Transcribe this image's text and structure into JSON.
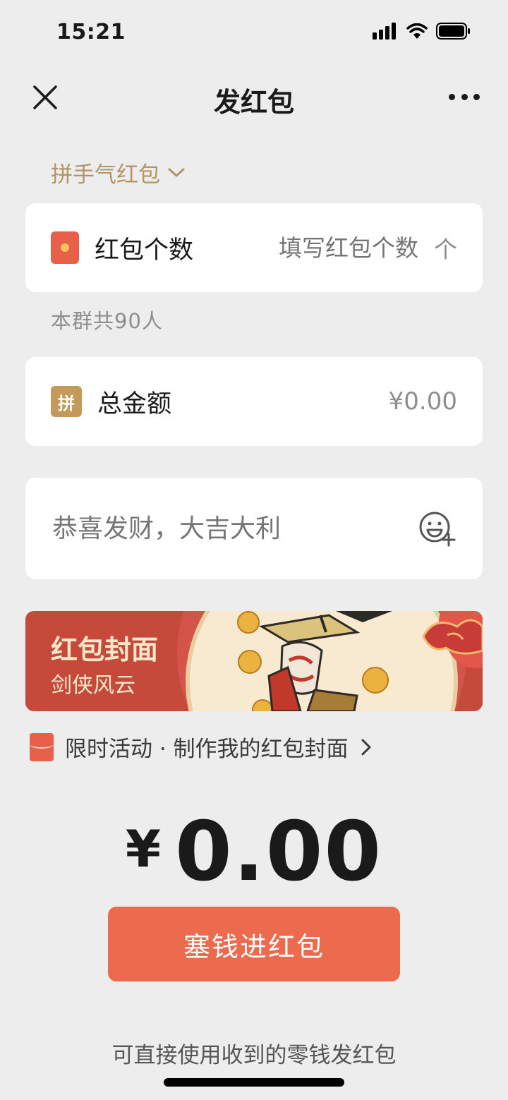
{
  "status_bar": {
    "time": "15:21"
  },
  "nav": {
    "title": "发红包"
  },
  "type_selector": {
    "label": "拼手气红包"
  },
  "count_row": {
    "label": "红包个数",
    "placeholder": "填写红包个数",
    "unit": "个"
  },
  "group_hint": "本群共90人",
  "amount_row": {
    "icon_text": "拼",
    "label": "总金额",
    "value": "¥0.00"
  },
  "greeting": {
    "placeholder": "恭喜发财，大吉大利"
  },
  "cover": {
    "title": "红包封面",
    "subtitle": "剑侠风云"
  },
  "promo": {
    "text": "限时活动 · 制作我的红包封面"
  },
  "total": {
    "symbol": "¥",
    "amount": "0.00"
  },
  "submit": {
    "label": "塞钱进红包"
  },
  "footer": {
    "text": "可直接使用收到的零钱发红包"
  },
  "colors": {
    "accent": "#ec6b4f",
    "gold": "#b39563",
    "cover_bg": "#c64a3b"
  },
  "icons": [
    "close-icon",
    "more-icon",
    "chevron-down-icon",
    "red-packet-icon",
    "pin-icon",
    "emoji-add-icon",
    "chevron-right-icon",
    "signal-icon",
    "wifi-icon",
    "battery-icon"
  ]
}
